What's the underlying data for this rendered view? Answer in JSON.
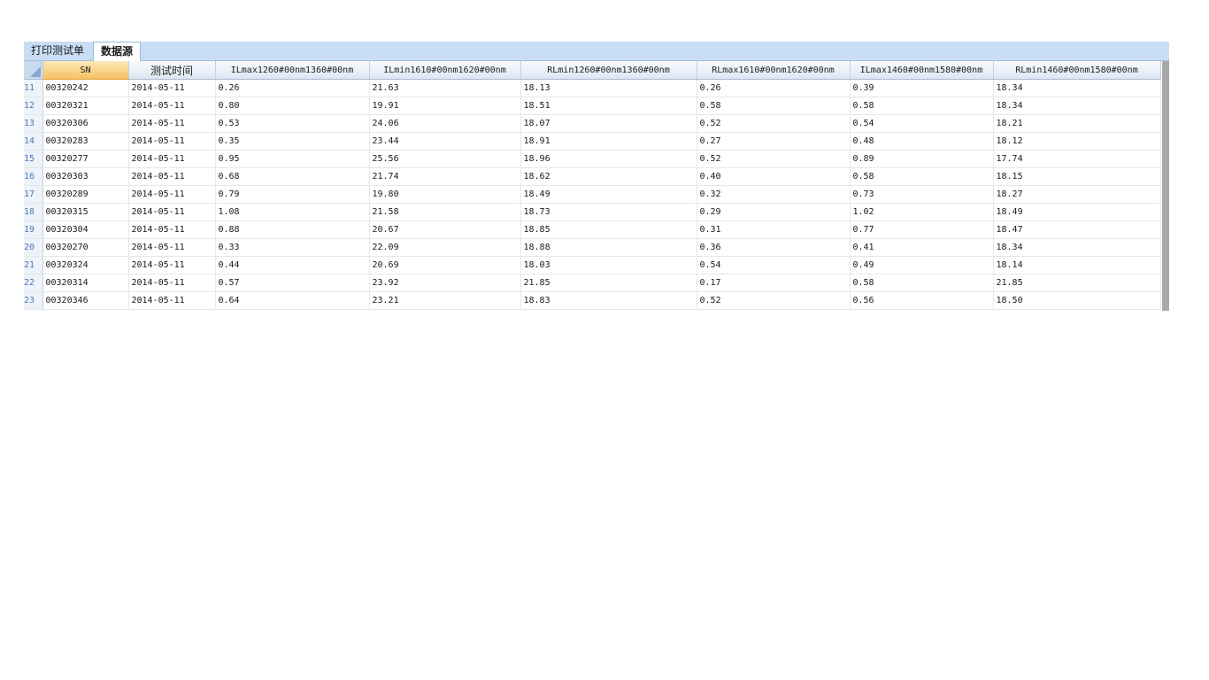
{
  "tabs": [
    {
      "label": "打印测试单",
      "active": false
    },
    {
      "label": "数据源",
      "active": true
    }
  ],
  "grid": {
    "columns": [
      "SN",
      "测试时间",
      "ILmax1260#00nm1360#00nm",
      "ILmin1610#00nm1620#00nm",
      "RLmin1260#00nm1360#00nm",
      "RLmax1610#00nm1620#00nm",
      "ILmax1460#00nm1580#00nm",
      "RLmin1460#00nm1580#00nm"
    ],
    "rows": [
      {
        "n": "11",
        "cells": [
          "00320242",
          "2014-05-11",
          "0.26",
          "21.63",
          "18.13",
          "0.26",
          "0.39",
          "18.34"
        ]
      },
      {
        "n": "12",
        "cells": [
          "00320321",
          "2014-05-11",
          "0.80",
          "19.91",
          "18.51",
          "0.58",
          "0.58",
          "18.34"
        ]
      },
      {
        "n": "13",
        "cells": [
          "00320306",
          "2014-05-11",
          "0.53",
          "24.06",
          "18.07",
          "0.52",
          "0.54",
          "18.21"
        ]
      },
      {
        "n": "14",
        "cells": [
          "00320283",
          "2014-05-11",
          "0.35",
          "23.44",
          "18.91",
          "0.27",
          "0.48",
          "18.12"
        ]
      },
      {
        "n": "15",
        "cells": [
          "00320277",
          "2014-05-11",
          "0.95",
          "25.56",
          "18.96",
          "0.52",
          "0.89",
          "17.74"
        ]
      },
      {
        "n": "16",
        "cells": [
          "00320303",
          "2014-05-11",
          "0.68",
          "21.74",
          "18.62",
          "0.40",
          "0.58",
          "18.15"
        ]
      },
      {
        "n": "17",
        "cells": [
          "00320289",
          "2014-05-11",
          "0.79",
          "19.80",
          "18.49",
          "0.32",
          "0.73",
          "18.27"
        ]
      },
      {
        "n": "18",
        "cells": [
          "00320315",
          "2014-05-11",
          "1.08",
          "21.58",
          "18.73",
          "0.29",
          "1.02",
          "18.49"
        ]
      },
      {
        "n": "19",
        "cells": [
          "00320304",
          "2014-05-11",
          "0.88",
          "20.67",
          "18.85",
          "0.31",
          "0.77",
          "18.47"
        ]
      },
      {
        "n": "20",
        "cells": [
          "00320270",
          "2014-05-11",
          "0.33",
          "22.09",
          "18.88",
          "0.36",
          "0.41",
          "18.34"
        ]
      },
      {
        "n": "21",
        "cells": [
          "00320324",
          "2014-05-11",
          "0.44",
          "20.69",
          "18.03",
          "0.54",
          "0.49",
          "18.14"
        ]
      },
      {
        "n": "22",
        "cells": [
          "00320314",
          "2014-05-11",
          "0.57",
          "23.92",
          "21.85",
          "0.17",
          "0.58",
          "21.85"
        ]
      },
      {
        "n": "23",
        "cells": [
          "00320346",
          "2014-05-11",
          "0.64",
          "23.21",
          "18.83",
          "0.52",
          "0.56",
          "18.50"
        ]
      }
    ]
  }
}
